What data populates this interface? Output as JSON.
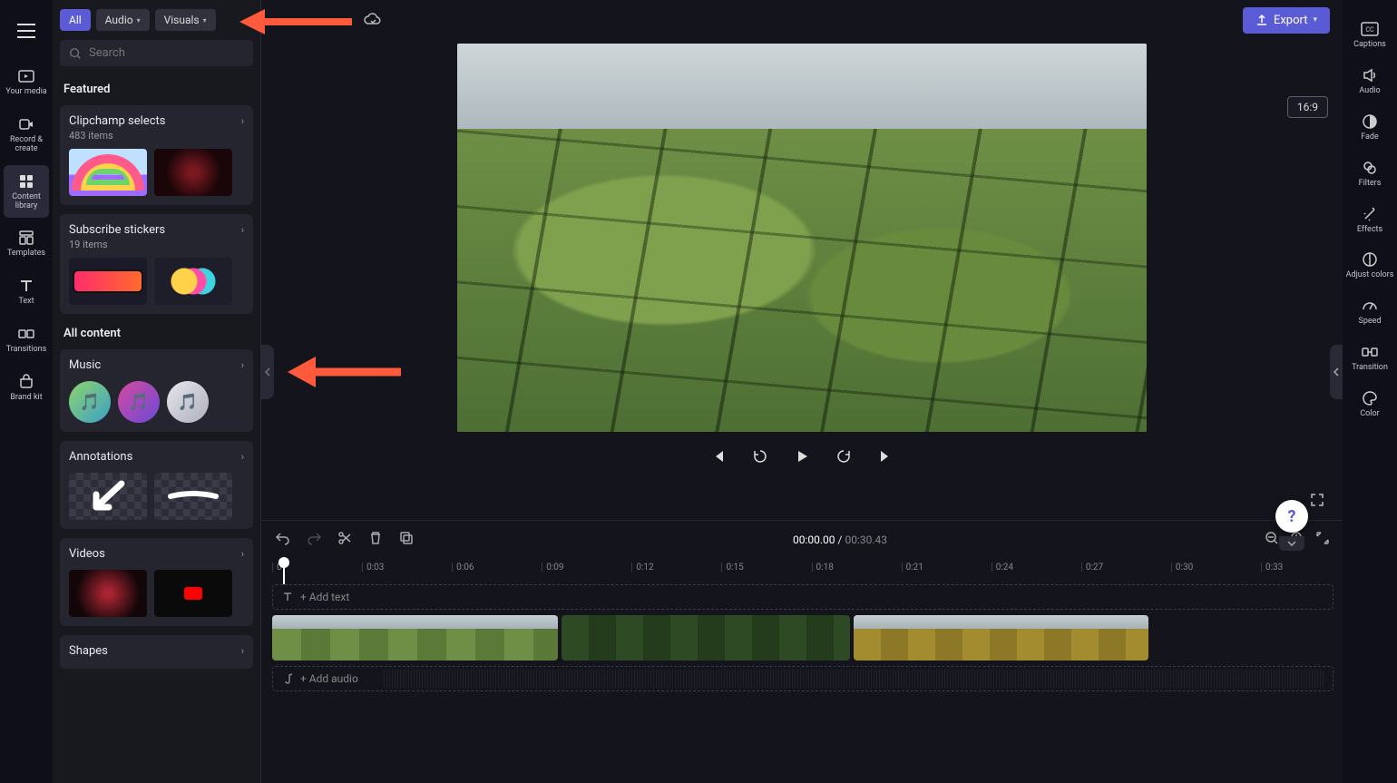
{
  "leftRail": {
    "items": [
      {
        "label": "Your media"
      },
      {
        "label": "Record & create"
      },
      {
        "label": "Content library"
      },
      {
        "label": "Templates"
      },
      {
        "label": "Text"
      },
      {
        "label": "Transitions"
      },
      {
        "label": "Brand kit"
      }
    ]
  },
  "panel": {
    "pills": {
      "all": "All",
      "audio": "Audio",
      "visuals": "Visuals"
    },
    "searchPlaceholder": "Search",
    "featured": "Featured",
    "clipchamp": {
      "title": "Clipchamp selects",
      "sub": "483 items"
    },
    "subscribe": {
      "title": "Subscribe stickers",
      "sub": "19 items"
    },
    "allContent": "All content",
    "music": "Music",
    "annotations": "Annotations",
    "videos": "Videos",
    "shapes": "Shapes"
  },
  "topbar": {
    "export": "Export"
  },
  "preview": {
    "aspect": "16:9"
  },
  "timeline": {
    "current": "00:00.00",
    "sep": " / ",
    "duration": "00:30.43",
    "addText": "+ Add text",
    "addAudio": "+ Add audio",
    "ticks": [
      "0",
      "0:03",
      "0:06",
      "0:09",
      "0:12",
      "0:15",
      "0:18",
      "0:21",
      "0:24",
      "0:27",
      "0:30",
      "0:33"
    ]
  },
  "rightRail": {
    "items": [
      {
        "label": "Captions"
      },
      {
        "label": "Audio"
      },
      {
        "label": "Fade"
      },
      {
        "label": "Filters"
      },
      {
        "label": "Effects"
      },
      {
        "label": "Adjust colors"
      },
      {
        "label": "Speed"
      },
      {
        "label": "Transition"
      },
      {
        "label": "Color"
      }
    ]
  },
  "help": "?"
}
